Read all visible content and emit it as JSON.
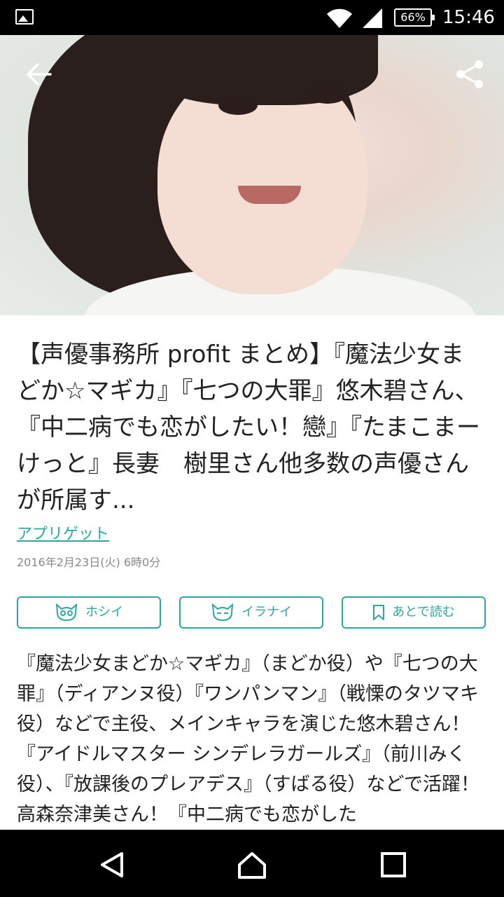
{
  "status_bar": {
    "battery": "66%",
    "time": "15:46"
  },
  "article": {
    "title": "【声優事務所 profit まとめ】『魔法少女まどか☆マギカ』『七つの大罪』悠木碧さん、『中二病でも恋がしたい！戀』『たまこまーけっと』長妻　樹里さん他多数の声優さんが所属す...",
    "source": "アプリゲット",
    "date": "2016年2月23日(火) 6時0分",
    "body": "『魔法少女まどか☆マギカ』（まどか役）や『七つの大罪』（ディアンヌ役）『ワンパンマン』（戦慄のタツマキ役）などで主役、メインキャラを演じた悠木碧さん！『アイドルマスター シンデレラガールズ』（前川みく役）、『放課後のプレアデス』（すばる役）などで活躍！高森奈津美さん！『中二病でも恋がした"
  },
  "actions": {
    "want": "ホシイ",
    "dont_want": "イラナイ",
    "read_later": "あとで読む"
  },
  "icons": {
    "back": "arrow-left-icon",
    "share": "share-icon",
    "mascot": "cat-face-icon",
    "bookmark": "bookmark-icon"
  },
  "colors": {
    "accent": "#2aa79f",
    "status_bar": "#000000",
    "nav_bar": "#000000"
  }
}
